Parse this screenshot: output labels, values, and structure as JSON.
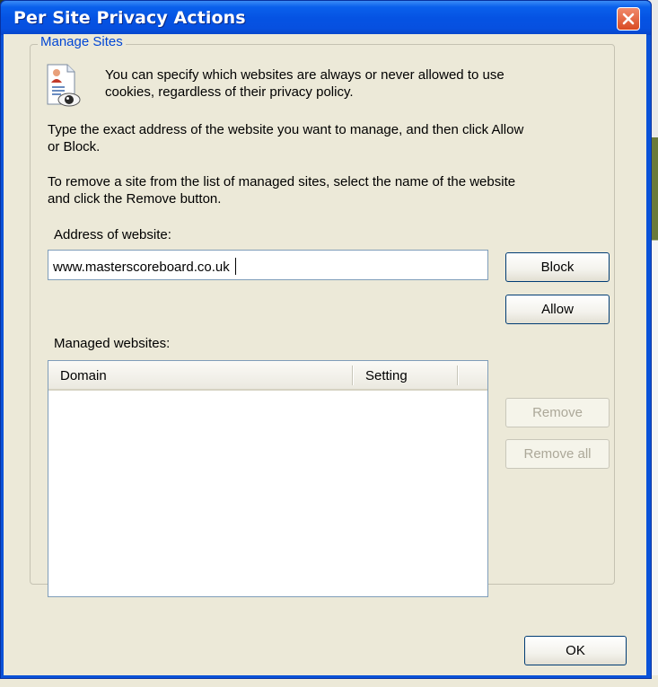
{
  "window": {
    "title": "Per Site Privacy Actions",
    "close_icon": "close-icon"
  },
  "group": {
    "label": "Manage Sites",
    "icon": "privacy-document-eye-icon",
    "intro_line1": "You can specify which websites are always or never allowed to use",
    "intro_line2": "cookies, regardless of their privacy policy.",
    "instruction1_line1": "Type the exact address of the website you want to manage, and then click Allow",
    "instruction1_line2": "or Block.",
    "instruction2_line1": "To remove a site from the list of managed sites, select the name of the website",
    "instruction2_line2": "and click the Remove button."
  },
  "address": {
    "label": "Address of website:",
    "value": "www.masterscoreboard.co.uk"
  },
  "buttons": {
    "block": "Block",
    "allow": "Allow",
    "remove": "Remove",
    "remove_all": "Remove all",
    "ok": "OK"
  },
  "managed": {
    "label": "Managed websites:",
    "columns": [
      "Domain",
      "Setting"
    ],
    "rows": []
  },
  "colors": {
    "title_bar": "#0553e3",
    "dialog_face": "#ece9d8",
    "group_label": "#0046d5",
    "close_button": "#d94a22"
  }
}
